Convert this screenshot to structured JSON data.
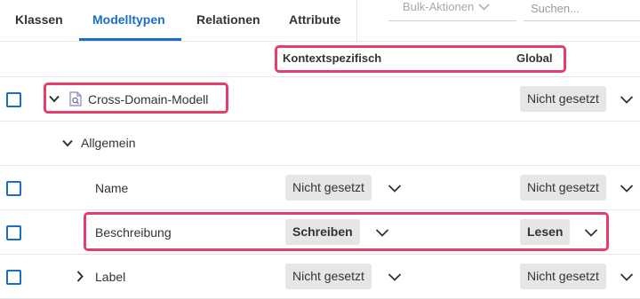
{
  "tabs": [
    "Klassen",
    "Modelltypen",
    "Relationen",
    "Attribute"
  ],
  "active_tab": "Modelltypen",
  "toolbar": {
    "bulk_label": "Bulk-Aktionen",
    "search_placeholder": "Suchen..."
  },
  "columns": {
    "context": "Kontextspezifisch",
    "global": "Global"
  },
  "rows": [
    {
      "label": "Cross-Domain-Modell",
      "context": "",
      "global": "Nicht gesetzt"
    },
    {
      "label": "Allgemein"
    },
    {
      "label": "Name",
      "context": "Nicht gesetzt",
      "global": "Nicht gesetzt"
    },
    {
      "label": "Beschreibung",
      "context": "Schreiben",
      "global": "Lesen"
    },
    {
      "label": "Label",
      "context": "Nicht gesetzt",
      "global": "Nicht gesetzt"
    }
  ],
  "colors": {
    "accent": "#1a6fc4",
    "highlight": "#e63d6a",
    "pill_bg": "#e6e6e6"
  },
  "icons": [
    "chevron-down-icon",
    "chevron-right-icon",
    "model-type-icon"
  ]
}
